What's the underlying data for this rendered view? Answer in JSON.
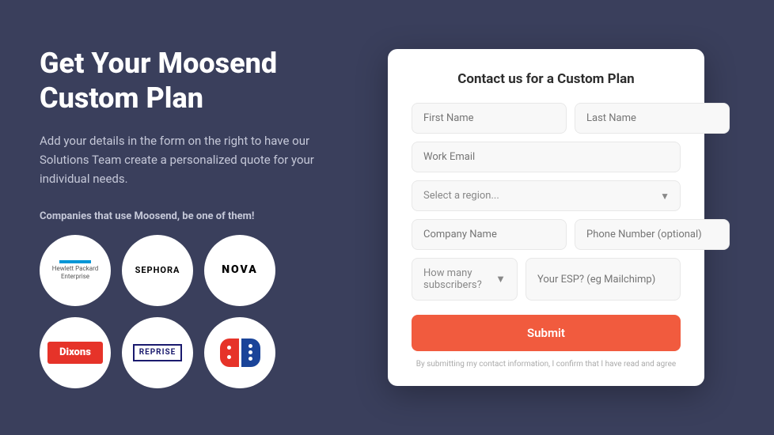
{
  "left": {
    "heading_line1": "Get Your Moosend",
    "heading_line2": "Custom Plan",
    "description": "Add your details in the form on the right to have our Solutions Team create a personalized quote for your individual needs.",
    "companies_label": "Companies that use Moosend, be one of them!",
    "logos": [
      {
        "id": "hp",
        "name": "Hewlett Packard Enterprise"
      },
      {
        "id": "sephora",
        "name": "SEPHORA"
      },
      {
        "id": "nova",
        "name": "NOVA"
      },
      {
        "id": "dixons",
        "name": "Dixons"
      },
      {
        "id": "reprise",
        "name": "REPRISE"
      },
      {
        "id": "dominos",
        "name": "Dominos"
      }
    ]
  },
  "form": {
    "title": "Contact us for a Custom Plan",
    "first_name_placeholder": "First Name",
    "last_name_placeholder": "Last Name",
    "work_email_placeholder": "Work Email",
    "region_placeholder": "Select a region...",
    "company_name_placeholder": "Company Name",
    "phone_placeholder": "Phone Number (optional)",
    "subscribers_placeholder": "How many subscribers?",
    "esp_placeholder": "Your ESP? (eg Mailchimp)",
    "submit_label": "Submit",
    "note": "By submitting my contact information, I confirm that I have read and agree"
  }
}
